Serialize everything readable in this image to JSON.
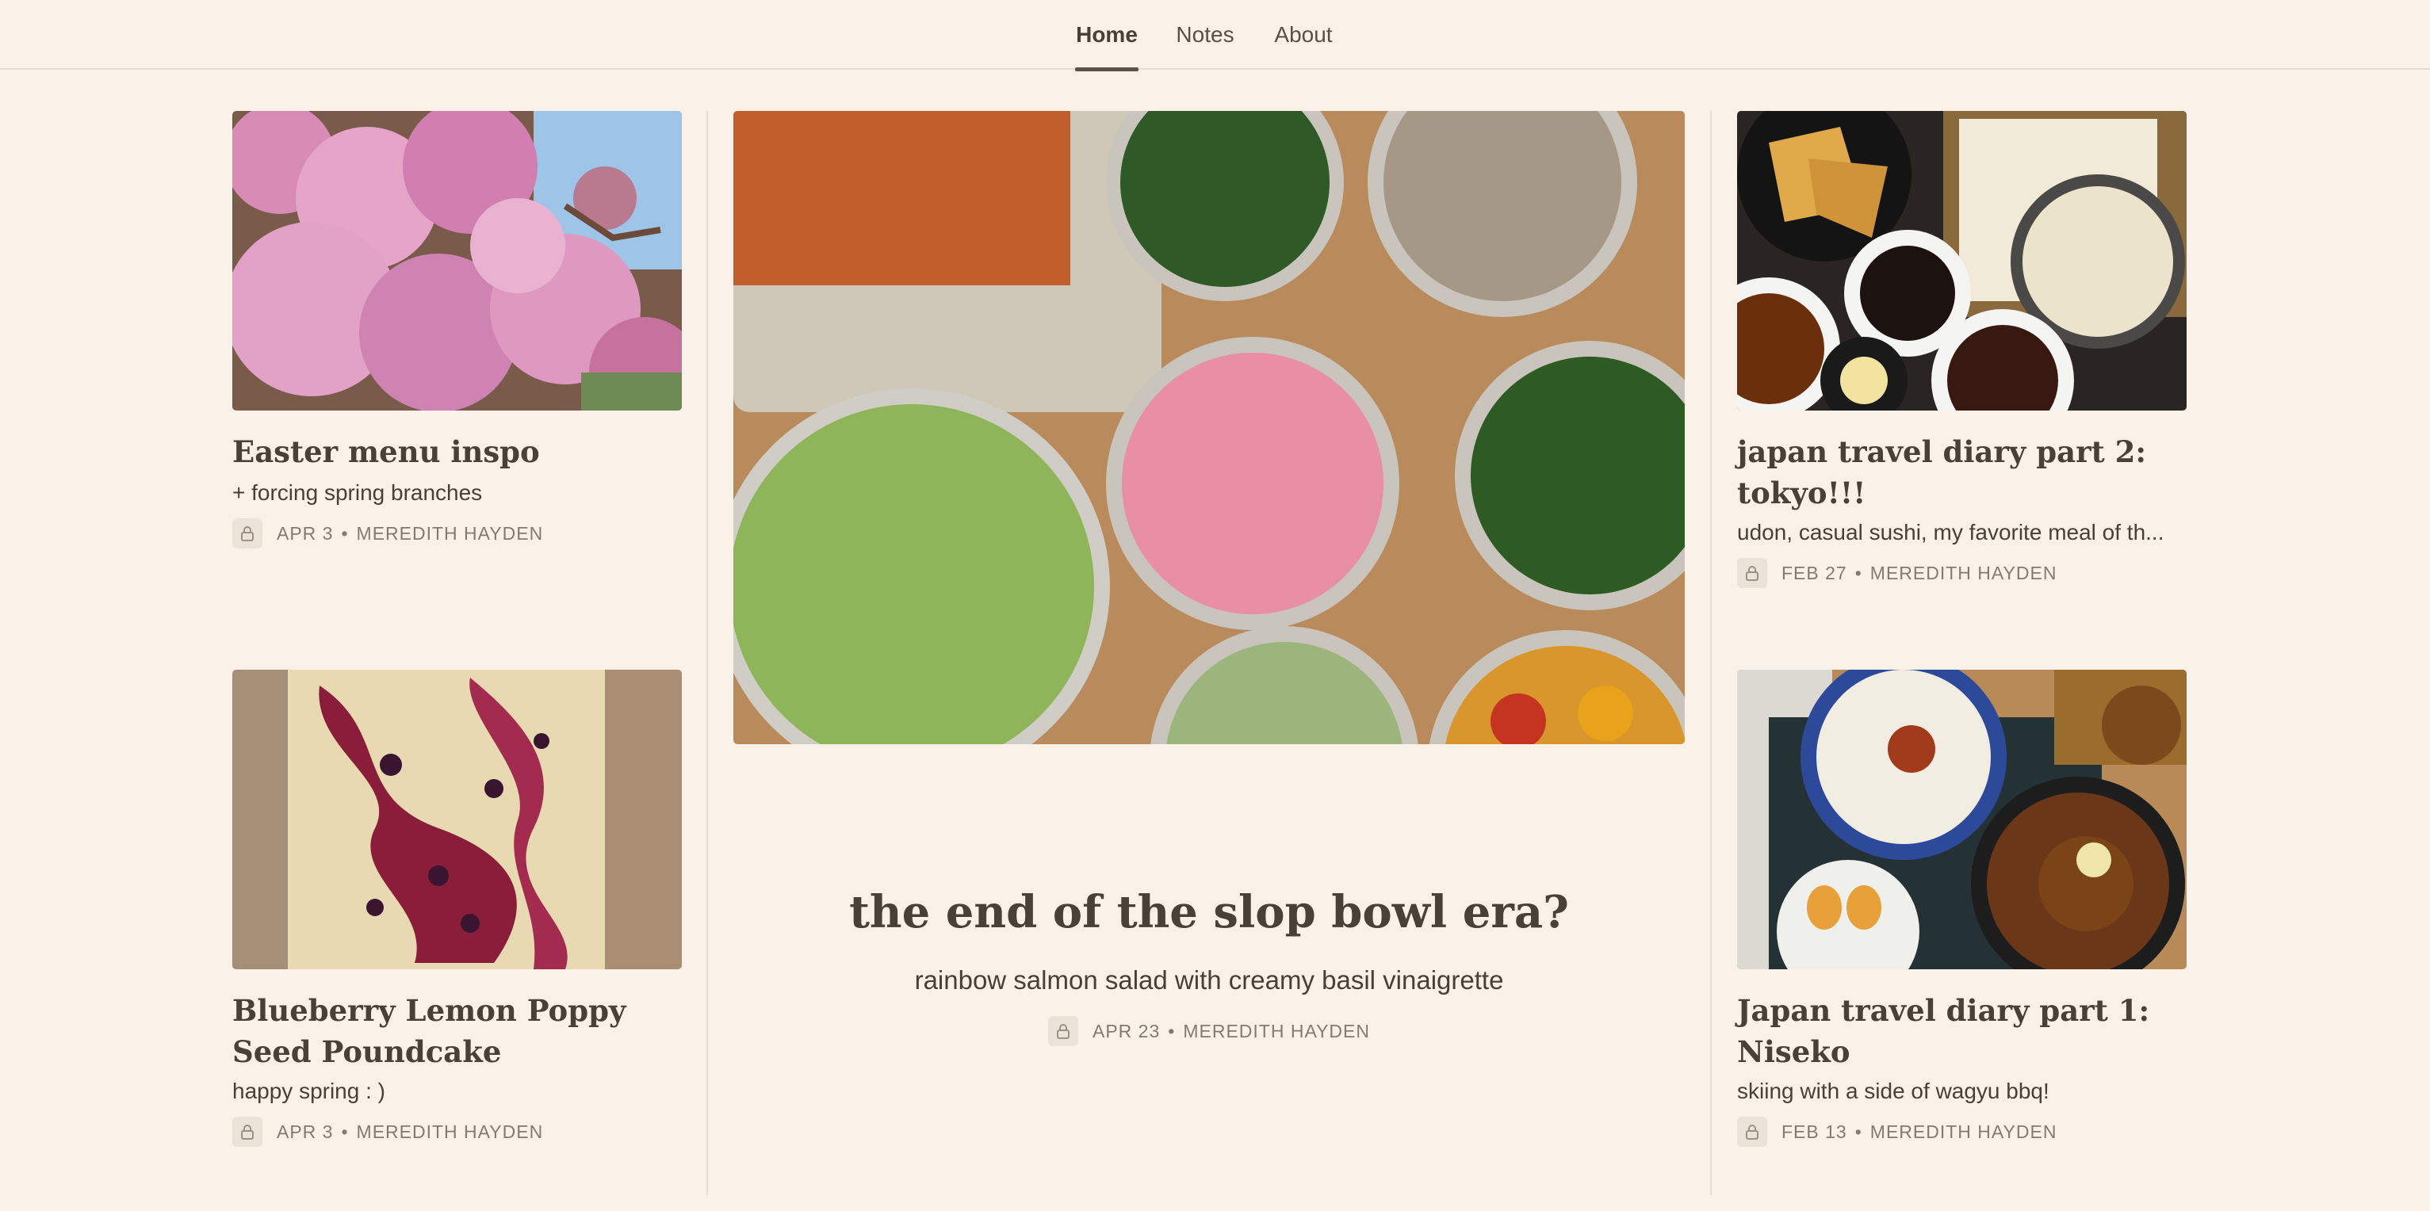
{
  "nav": {
    "tabs": [
      {
        "label": "Home",
        "active": true
      },
      {
        "label": "Notes",
        "active": false
      },
      {
        "label": "About",
        "active": false
      }
    ]
  },
  "posts": {
    "easter": {
      "title": "Easter menu inspo",
      "subtitle": "+ forcing spring branches",
      "date": "APR 3",
      "author": "MEREDITH HAYDEN",
      "image": "pink-blossoms-photo"
    },
    "poundcake": {
      "title": "Blueberry Lemon Poppy Seed Poundcake",
      "subtitle": "happy spring : )",
      "date": "APR 3",
      "author": "MEREDITH HAYDEN",
      "image": "blueberry-poundcake-photo"
    },
    "featured": {
      "title": "the end of the slop bowl era?",
      "subtitle": "rainbow salmon salad with creamy basil vinaigrette",
      "date": "APR 23",
      "author": "MEREDITH HAYDEN",
      "image": "salmon-salad-bowls-photo"
    },
    "tokyo": {
      "title": "japan travel diary part 2: tokyo!!!",
      "subtitle": "udon, casual sushi, my favorite meal of th...",
      "date": "FEB 27",
      "author": "MEREDITH HAYDEN",
      "image": "udon-tempura-photo"
    },
    "niseko": {
      "title": "Japan travel diary part 1: Niseko",
      "subtitle": "skiing with a side of wagyu bbq!",
      "date": "FEB 13",
      "author": "MEREDITH HAYDEN",
      "image": "ramen-tray-photo"
    }
  },
  "meta_separator": "•",
  "icons": {
    "lock": "lock-icon"
  },
  "colors": {
    "background": "#faf2e8",
    "text": "#4a3f37",
    "muted": "#857a70",
    "divider": "#e6ddd2"
  }
}
